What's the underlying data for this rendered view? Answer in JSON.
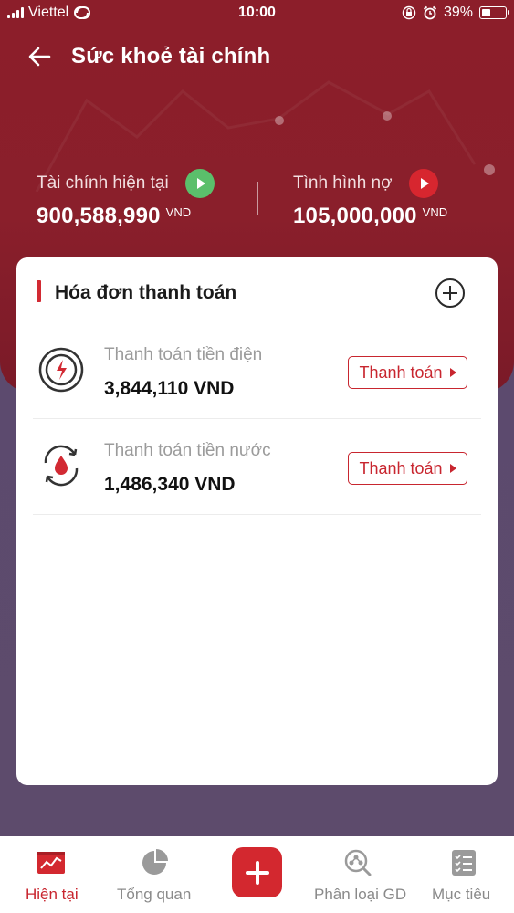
{
  "status_bar": {
    "carrier": "Viettel",
    "time": "10:00",
    "battery": "39%",
    "battery_level": 0.39
  },
  "header": {
    "title": "Sức khoẻ tài chính",
    "back_icon": "arrow-left-icon"
  },
  "summary": {
    "current": {
      "label": "Tài chính hiện tại",
      "value": "900,588,990",
      "unit": "VND",
      "button_color": "#5bbf6b"
    },
    "debt": {
      "label": "Tình hình nợ",
      "value": "105,000,000",
      "unit": "VND",
      "button_color": "#d7262f"
    }
  },
  "bills_card": {
    "title": "Hóa đơn thanh toán",
    "add_icon": "plus-circle-icon",
    "items": [
      {
        "name": "Thanh toán tiền điện",
        "amount": "3,844,110 VND",
        "icon": "electricity-icon",
        "button": "Thanh toán"
      },
      {
        "name": "Thanh toán tiền nước",
        "amount": "1,486,340 VND",
        "icon": "water-icon",
        "button": "Thanh toán"
      }
    ]
  },
  "tabbar": {
    "tabs": [
      {
        "label": "Hiện tại",
        "icon": "chart-trend-icon",
        "active": true
      },
      {
        "label": "Tổng quan",
        "icon": "pie-chart-icon",
        "active": false
      },
      {
        "label": "Phân loại GD",
        "icon": "category-search-icon",
        "active": false
      },
      {
        "label": "Mục tiêu",
        "icon": "checklist-icon",
        "active": false
      }
    ],
    "fab_icon": "plus-icon"
  },
  "colors": {
    "brand_red": "#c8262f",
    "hero": "#8a1f2b",
    "background": "#5d4b6b"
  }
}
